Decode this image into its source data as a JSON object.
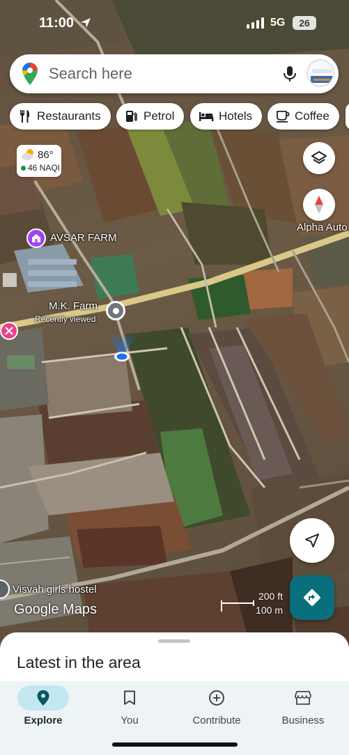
{
  "status_bar": {
    "time": "11:00",
    "network": "5G",
    "battery": "26"
  },
  "search": {
    "placeholder": "Search here"
  },
  "chips": [
    {
      "label": "Restaurants",
      "icon": "fork-knife-icon"
    },
    {
      "label": "Petrol",
      "icon": "fuel-icon"
    },
    {
      "label": "Hotels",
      "icon": "bed-icon"
    },
    {
      "label": "Coffee",
      "icon": "coffee-cup-icon"
    }
  ],
  "weather": {
    "temp": "86°",
    "aqi": "46 NAQI"
  },
  "map_labels": {
    "avsar_farm": "AVSAR FARM",
    "mk_farm": "M.K. Farm",
    "recently_viewed": "Recently viewed",
    "alpha_auto": "Alpha Auto",
    "hostel": "Visvah girls hostel"
  },
  "scale": {
    "feet": "200 ft",
    "meters": "100 m"
  },
  "logo": "Google Maps",
  "sheet": {
    "title": "Latest in the area"
  },
  "nav": [
    {
      "label": "Explore",
      "icon": "pin-icon",
      "active": true
    },
    {
      "label": "You",
      "icon": "bookmark-icon",
      "active": false
    },
    {
      "label": "Contribute",
      "icon": "plus-circle-icon",
      "active": false
    },
    {
      "label": "Business",
      "icon": "storefront-icon",
      "active": false
    }
  ],
  "colors": {
    "accent": "#0a6f7c",
    "nav_active": "#c2e7f0",
    "sheet_bg": "#ffffff",
    "nav_bg": "#eef3f6"
  }
}
